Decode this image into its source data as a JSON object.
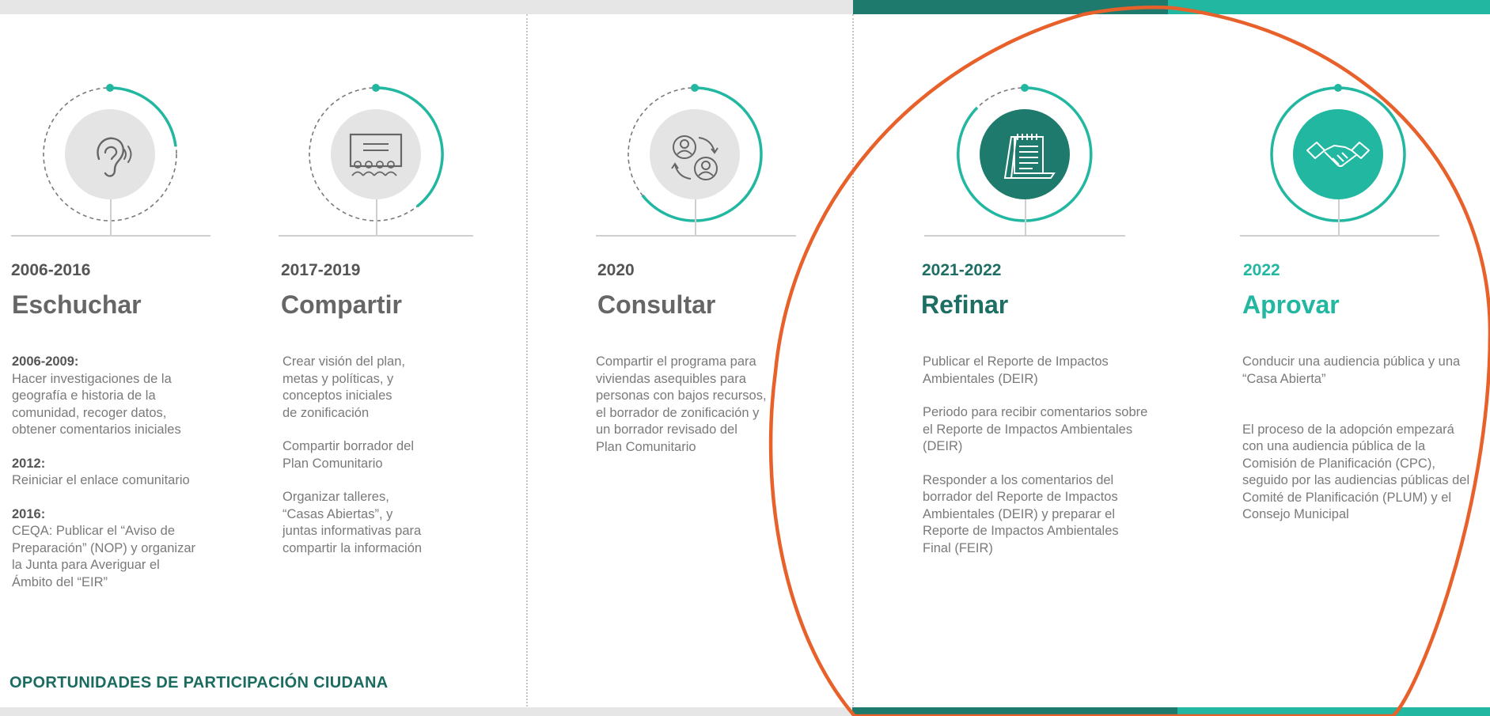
{
  "colors": {
    "bar_gray": "#e6e6e6",
    "dark_teal": "#1f7a6e",
    "light_teal": "#21b7a0",
    "annotation_orange": "#e8602a"
  },
  "stages": [
    {
      "years": "2006-2016",
      "verb": "Eschuchar",
      "icon": "ear-icon",
      "blocks": [
        {
          "label": "2006-2009:",
          "text": "Hacer investigaciones de la\ngeografía e historia de la\ncomunidad, recoger datos,\nobtener comentarios iniciales"
        },
        {
          "label": "2012:",
          "text": "Reiniciar el enlace comunitario"
        },
        {
          "label": "2016:",
          "text": "CEQA: Publicar el “Aviso de\nPreparación” (NOP) y organizar\nla Junta para Averiguar el\nÁmbito del “EIR”"
        }
      ]
    },
    {
      "years": "2017-2019",
      "verb": "Compartir",
      "icon": "presentation-audience-icon",
      "blocks": [
        {
          "label": "",
          "text": "Crear visión del plan,\nmetas y políticas, y\nconceptos iniciales\nde zonificación"
        },
        {
          "label": "",
          "text": "Compartir borrador del\nPlan Comunitario"
        },
        {
          "label": "",
          "text": "Organizar talleres,\n“Casas Abiertas”, y\njuntas informativas para\ncompartir la información"
        }
      ]
    },
    {
      "years": "2020",
      "verb": "Consultar",
      "icon": "people-exchange-icon",
      "blocks": [
        {
          "label": "",
          "text": "Compartir el programa para\nviviendas asequibles para\npersonas con bajos recursos,\nel borrador de zonificación y\nun borrador revisado del\nPlan Comunitario"
        }
      ]
    },
    {
      "years": "2021-2022",
      "verb": "Refinar",
      "icon": "document-notepad-icon",
      "blocks": [
        {
          "label": "",
          "text": "Publicar el Reporte de Impactos\nAmbientales (DEIR)"
        },
        {
          "label": "",
          "text": "Periodo para recibir comentarios sobre\nel Reporte de Impactos Ambientales\n(DEIR)"
        },
        {
          "label": "",
          "text": "Responder a los comentarios del\nborrador del Reporte de Impactos\nAmbientales (DEIR) y preparar el\nReporte de Impactos Ambientales\nFinal (FEIR)"
        }
      ]
    },
    {
      "years": "2022",
      "verb": "Aprovar",
      "icon": "handshake-icon",
      "blocks": [
        {
          "label": "",
          "text": "Conducir una audiencia pública y una\n“Casa Abierta”"
        },
        {
          "label": "",
          "text": "\nEl proceso de la adopción empezará\ncon una audiencia pública de la\nComisión de Planificación (CPC),\nseguido por las audiencias públicas del\nComité de Planificación (PLUM) y el\nConsejo Municipal"
        }
      ]
    }
  ],
  "footer_title": "OPORTUNIDADES DE PARTICIPACIÓN CIUDANA"
}
